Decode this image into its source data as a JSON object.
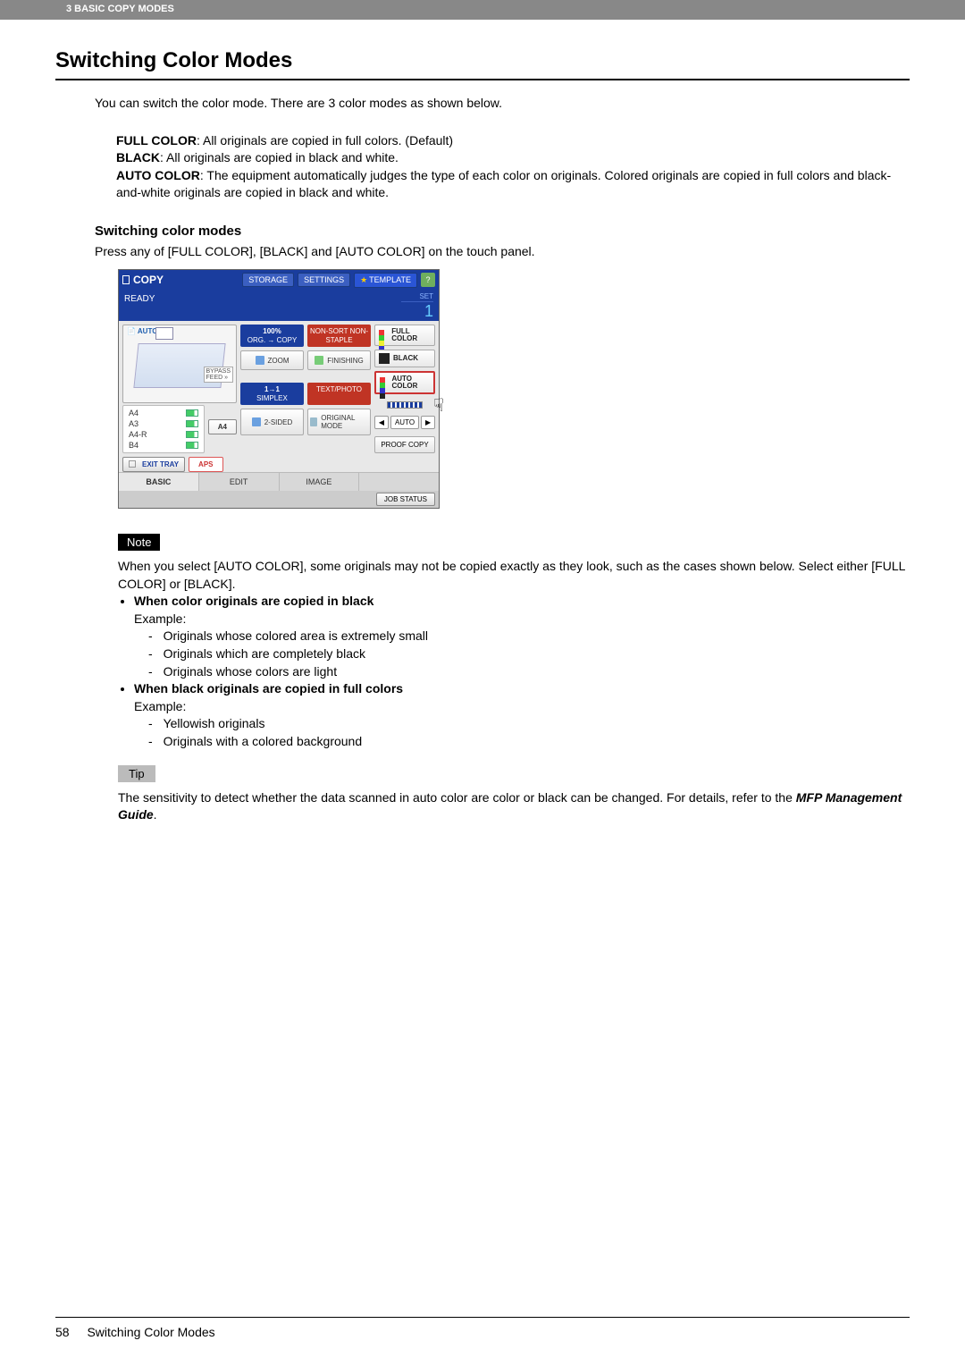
{
  "header": {
    "chapter": "3 BASIC COPY MODES"
  },
  "title": "Switching Color Modes",
  "intro": "You can switch the color mode. There are 3 color modes as shown below.",
  "modes": {
    "full_label": "FULL COLOR",
    "full_text": ": All originals are copied in full colors. (Default)",
    "black_label": "BLACK",
    "black_text": ": All originals are copied in black and white.",
    "auto_label": "AUTO COLOR",
    "auto_text": ": The equipment automatically judges the type of each color on originals. Colored originals are copied in full colors and black-and-white originals are copied in black and white."
  },
  "sub": {
    "heading": "Switching color modes",
    "desc": "Press any of [FULL COLOR], [BLACK] and [AUTO COLOR] on the touch panel."
  },
  "panel": {
    "copy": "COPY",
    "storage": "STORAGE",
    "settings": "SETTINGS",
    "template": "TEMPLATE",
    "help": "?",
    "ready": "READY",
    "set": "SET",
    "count": "1",
    "auto": "AUTO",
    "bypass1": "BYPASS",
    "bypass2": "FEED",
    "trays": [
      "A4",
      "A3",
      "A4-R",
      "B4"
    ],
    "aps_a4": "A4",
    "exit_tray": "EXIT TRAY",
    "aps": "APS",
    "zoom_top_l1": "100%",
    "zoom_top_l2": "ORG. → COPY",
    "nonsort": "NON-SORT NON-STAPLE",
    "zoom": "ZOOM",
    "finishing": "FINISHING",
    "simplex_l1": "1→1",
    "simplex_l2": "SIMPLEX",
    "textphoto": "TEXT/PHOTO",
    "twosided": "2-SIDED",
    "orig_mode": "ORIGINAL MODE",
    "full_color": "FULL COLOR",
    "black": "BLACK",
    "auto_color": "AUTO COLOR",
    "auto_label": "AUTO",
    "left": "◀",
    "right": "▶",
    "proof": "PROOF COPY",
    "tabs": {
      "basic": "BASIC",
      "edit": "EDIT",
      "image": "IMAGE"
    },
    "job_status": "JOB STATUS"
  },
  "note": {
    "label": "Note",
    "lead": "When you select [AUTO COLOR], some originals may not be copied exactly as they look, such as the cases shown below. Select either [FULL COLOR] or [BLACK].",
    "b1": {
      "title": "When color originals are copied in black",
      "example": "Example:",
      "items": [
        "Originals whose colored area is extremely small",
        "Originals which are completely black",
        "Originals whose colors are light"
      ]
    },
    "b2": {
      "title": "When black originals are copied in full colors",
      "example": "Example:",
      "items": [
        "Yellowish originals",
        "Originals with a colored background"
      ]
    }
  },
  "tip": {
    "label": "Tip",
    "text": "The sensitivity to detect whether the data scanned in auto color are color or black can be changed. For details, refer to the ",
    "ref": "MFP Management Guide",
    "end": "."
  },
  "footer": {
    "page": "58",
    "title": "Switching Color Modes"
  }
}
